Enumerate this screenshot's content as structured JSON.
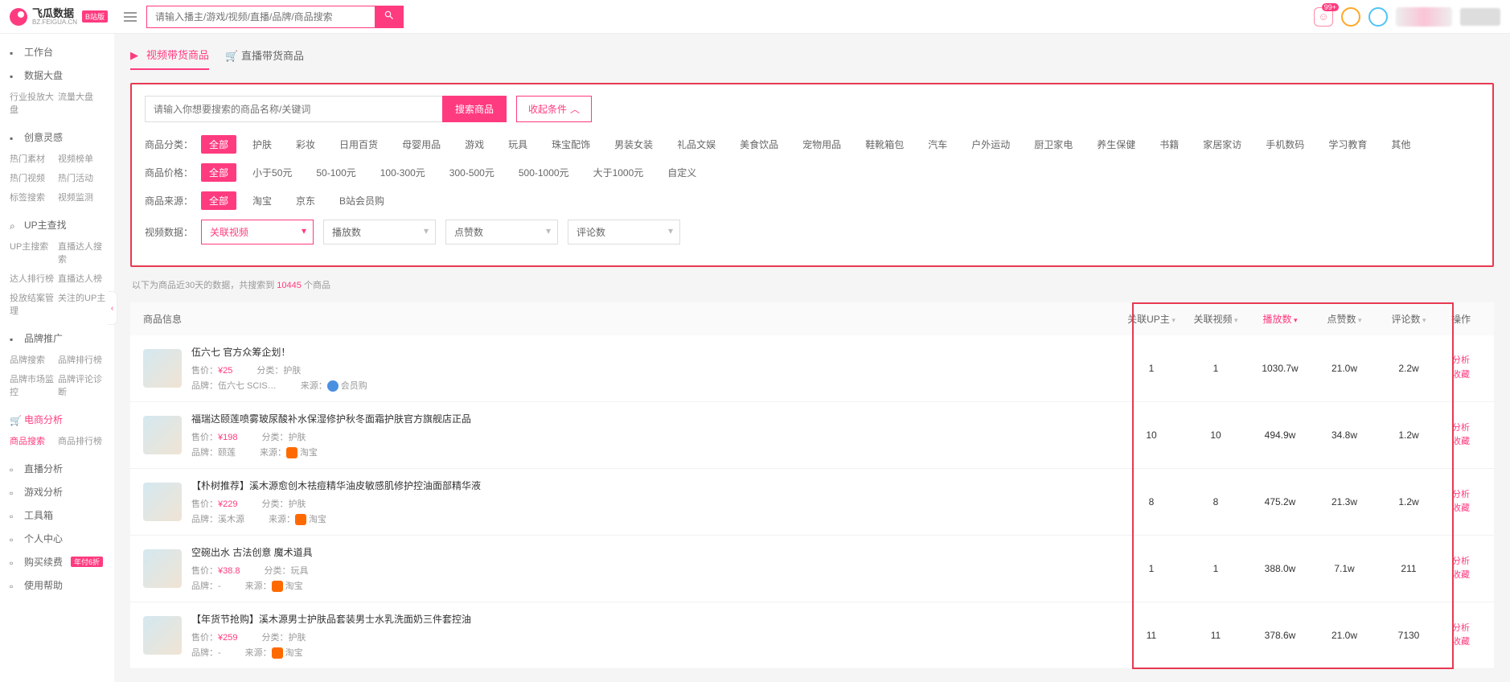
{
  "header": {
    "brand": "飞瓜数据",
    "brand_sub": "BZ.FEIGUA.CN",
    "brand_badge": "B站版",
    "search_placeholder": "请输入播主/游戏/视频/直播/品牌/商品搜索",
    "notif_badge": "99+"
  },
  "sidebar": [
    {
      "label": "工作台",
      "icon": "home",
      "subs": []
    },
    {
      "label": "数据大盘",
      "icon": "dashboard",
      "subs": [
        "行业投放大盘",
        "流量大盘"
      ]
    },
    {
      "label": "创意灵感",
      "icon": "bulb",
      "subs": [
        "热门素材",
        "视频榜单",
        "热门视频",
        "热门活动",
        "标签搜索",
        "视频监测"
      ]
    },
    {
      "label": "UP主查找",
      "icon": "search",
      "subs": [
        "UP主搜索",
        "直播达人搜索",
        "达人排行榜",
        "直播达人榜",
        "投放结案管理",
        "关注的UP主"
      ]
    },
    {
      "label": "品牌推广",
      "icon": "tag",
      "subs": [
        "品牌搜索",
        "品牌排行榜",
        "品牌市场监控",
        "品牌评论诊断"
      ]
    },
    {
      "label": "电商分析",
      "icon": "cart",
      "active": true,
      "subs": [
        "商品搜索",
        "商品排行榜"
      ],
      "active_sub": 0
    },
    {
      "label": "直播分析",
      "icon": "live",
      "subs": []
    },
    {
      "label": "游戏分析",
      "icon": "game",
      "subs": []
    },
    {
      "label": "工具箱",
      "icon": "tool",
      "subs": []
    },
    {
      "label": "个人中心",
      "icon": "user",
      "subs": []
    },
    {
      "label": "购买续费",
      "icon": "buy",
      "badge": "年付6折",
      "subs": []
    },
    {
      "label": "使用帮助",
      "icon": "help",
      "subs": []
    }
  ],
  "tabs": [
    {
      "label": "视频带货商品",
      "active": true
    },
    {
      "label": "直播带货商品",
      "active": false
    }
  ],
  "filter": {
    "search_placeholder": "请输入你想要搜索的商品名称/关键词",
    "search_btn": "搜索商品",
    "collapse_btn": "收起条件",
    "rows": [
      {
        "label": "商品分类：",
        "chips": [
          "全部",
          "护肤",
          "彩妆",
          "日用百货",
          "母婴用品",
          "游戏",
          "玩具",
          "珠宝配饰",
          "男装女装",
          "礼品文娱",
          "美食饮品",
          "宠物用品",
          "鞋靴箱包",
          "汽车",
          "户外运动",
          "厨卫家电",
          "养生保健",
          "书籍",
          "家居家访",
          "手机数码",
          "学习教育",
          "其他"
        ],
        "active": 0
      },
      {
        "label": "商品价格：",
        "chips": [
          "全部",
          "小于50元",
          "50-100元",
          "100-300元",
          "300-500元",
          "500-1000元",
          "大于1000元",
          "自定义"
        ],
        "active": 0
      },
      {
        "label": "商品来源：",
        "chips": [
          "全部",
          "淘宝",
          "京东",
          "B站会员购"
        ],
        "active": 0
      }
    ],
    "video_label": "视频数据：",
    "selects": [
      {
        "label": "关联视频",
        "selected": true
      },
      {
        "label": "播放数",
        "selected": false
      },
      {
        "label": "点赞数",
        "selected": false
      },
      {
        "label": "评论数",
        "selected": false
      }
    ]
  },
  "hint": {
    "prefix": "以下为商品近30天的数据，共搜索到 ",
    "count": "10445",
    "suffix": " 个商品"
  },
  "table": {
    "headers": {
      "info": "商品信息",
      "up": "关联UP主",
      "video": "关联视频",
      "play": "播放数",
      "like": "点赞数",
      "comment": "评论数",
      "op": "操作"
    },
    "sort_active": "play",
    "op_analyze": "分析",
    "op_fav": "收藏",
    "price_label": "售价：",
    "brand_label": "品牌：",
    "cat_label": "分类：",
    "src_label": "来源：",
    "rows": [
      {
        "title": "伍六七 官方众筹企划！",
        "price": "¥25",
        "brand": "伍六七 SCIS…",
        "cat": "护肤",
        "src": "会员购",
        "src_icon": "hui",
        "up": "1",
        "video": "1",
        "play": "1030.7w",
        "like": "21.0w",
        "comment": "2.2w"
      },
      {
        "title": "福瑞达颐莲喷雾玻尿酸补水保湿修护秋冬面霜护肤官方旗舰店正品",
        "price": "¥198",
        "brand": "颐莲",
        "cat": "护肤",
        "src": "淘宝",
        "src_icon": "tb",
        "up": "10",
        "video": "10",
        "play": "494.9w",
        "like": "34.8w",
        "comment": "1.2w"
      },
      {
        "title": "【朴树推荐】溪木源愈创木祛痘精华油皮敏感肌修护控油面部精华液",
        "price": "¥229",
        "brand": "溪木源",
        "cat": "护肤",
        "src": "淘宝",
        "src_icon": "tb",
        "up": "8",
        "video": "8",
        "play": "475.2w",
        "like": "21.3w",
        "comment": "1.2w"
      },
      {
        "title": "空碗出水 古法创意 魔术道具",
        "price": "¥38.8",
        "brand": "-",
        "cat": "玩具",
        "src": "淘宝",
        "src_icon": "tb",
        "up": "1",
        "video": "1",
        "play": "388.0w",
        "like": "7.1w",
        "comment": "211"
      },
      {
        "title": "【年货节抢购】溪木源男士护肤品套装男士水乳洗面奶三件套控油",
        "price": "¥259",
        "brand": "-",
        "cat": "护肤",
        "src": "淘宝",
        "src_icon": "tb",
        "up": "11",
        "video": "11",
        "play": "378.6w",
        "like": "21.0w",
        "comment": "7130"
      }
    ]
  }
}
